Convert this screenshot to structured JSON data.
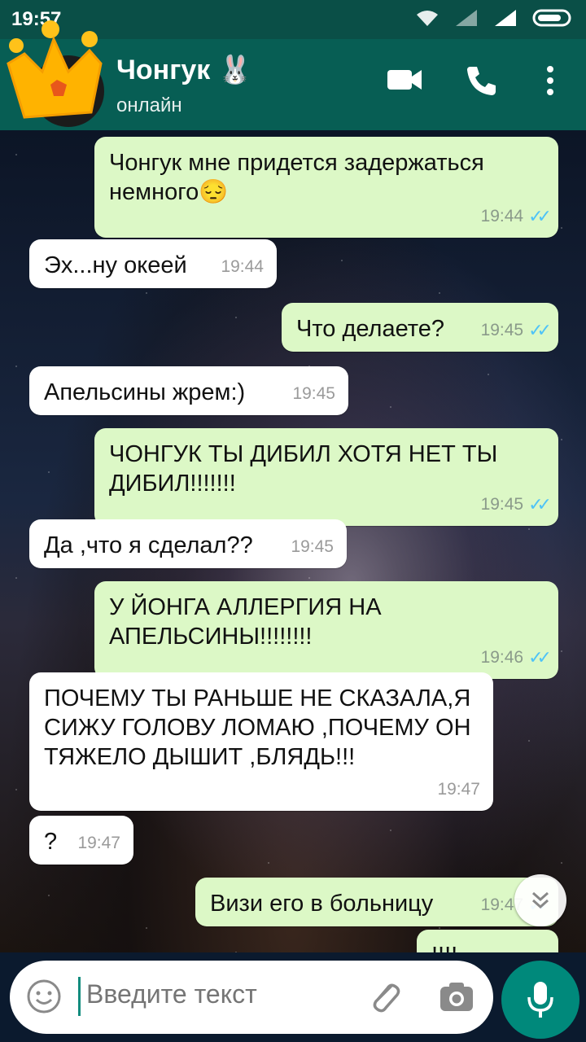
{
  "status": {
    "time": "19:57"
  },
  "header": {
    "title": "Чонгук 🐰",
    "subtitle": "онлайн"
  },
  "messages": [
    {
      "text": "Чонгук мне придется задержаться немного😔",
      "time": "19:44"
    },
    {
      "text": "Эх...ну океей",
      "time": "19:44"
    },
    {
      "text": "Что делаете?",
      "time": "19:45"
    },
    {
      "text": "Апельсины жрем:)",
      "time": "19:45"
    },
    {
      "text": "ЧОНГУК ТЫ ДИБИЛ ХОТЯ НЕТ ТЫ ДИБИЛ!!!!!!!",
      "time": "19:45"
    },
    {
      "text": "Да ,что я сделал??",
      "time": "19:45"
    },
    {
      "text": "У ЙОНГА АЛЛЕРГИЯ НА АПЕЛЬСИНЫ!!!!!!!!",
      "time": "19:46"
    },
    {
      "text": "ПОЧЕМУ ТЫ РАНЬШЕ НЕ СКАЗАЛА,Я СИЖУ ГОЛОВУ ЛОМАЮ ,ПОЧЕМУ ОН ТЯЖЕЛО ДЫШИТ ,БЛЯДЬ!!!",
      "time": "19:47"
    },
    {
      "text": "?",
      "time": "19:47"
    },
    {
      "text": "Визи его в больницу",
      "time": "19:47"
    },
    {
      "text": "!!!!",
      "time": ""
    }
  ],
  "input": {
    "placeholder": "Введите текст"
  },
  "icons": {
    "video": "video-call-icon",
    "phone": "phone-icon",
    "menu": "more-vert-icon",
    "emoji": "emoji-icon",
    "attach": "paperclip-icon",
    "camera": "camera-icon",
    "mic": "mic-icon",
    "scroll": "chevron-double-down-icon"
  },
  "colors": {
    "header": "#075e54",
    "outgoing": "#dcf8c6",
    "incoming": "#ffffff",
    "ticks": "#4fc3f7",
    "accent": "#00897b"
  }
}
